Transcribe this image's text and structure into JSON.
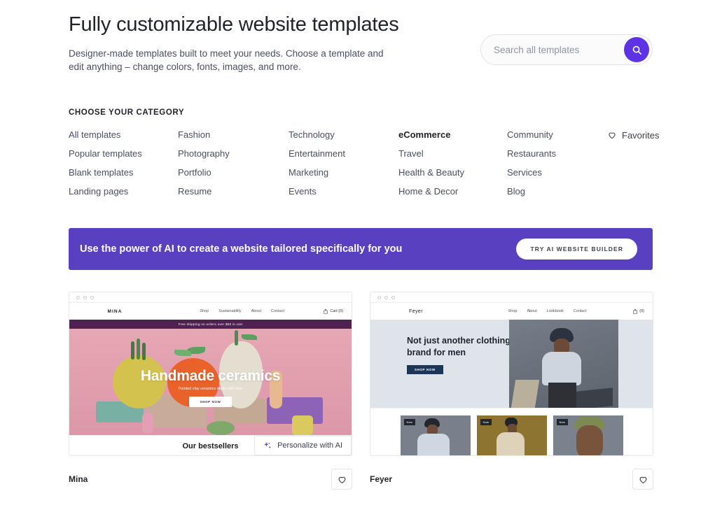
{
  "header": {
    "title": "Fully customizable website templates",
    "subtitle": "Designer-made templates built to meet your needs. Choose a template and edit anything – change colors, fonts, images, and more."
  },
  "search": {
    "placeholder": "Search all templates",
    "value": "",
    "button_icon": "search-icon",
    "button_color": "#5e33e6"
  },
  "categories": {
    "heading": "CHOOSE YOUR CATEGORY",
    "columns": [
      [
        "All templates",
        "Popular templates",
        "Blank templates",
        "Landing pages"
      ],
      [
        "Fashion",
        "Photography",
        "Portfolio",
        "Resume"
      ],
      [
        "Technology",
        "Entertainment",
        "Marketing",
        "Events"
      ],
      [
        "eCommerce",
        "Travel",
        "Health & Beauty",
        "Home & Decor"
      ],
      [
        "Community",
        "Restaurants",
        "Services",
        "Blog"
      ]
    ],
    "active": "eCommerce",
    "favorites": {
      "label": "Favorites",
      "icon": "heart-icon"
    }
  },
  "ai_banner": {
    "text": "Use the power of AI to create a website tailored specifically for you",
    "button_label": "TRY AI WEBSITE BUILDER",
    "background": "#5840c0"
  },
  "templates": [
    {
      "name": "Mina",
      "favorite_icon": "heart-icon",
      "personalize_label": "Personalize with AI",
      "personalize_icon": "sparkle-icon",
      "preview": {
        "logo": "MINA",
        "nav": [
          "Shop",
          "Sustainability",
          "About",
          "Contact"
        ],
        "cart": "Cart (0)",
        "announcement": "Free shipping on orders over $50 in cart",
        "hero_title": "Handmade ceramics",
        "hero_subtitle": "Painted clay ceramics made with love",
        "hero_button": "SHOP NOW",
        "section_title": "Our bestsellers",
        "accent": "#4e2150",
        "hero_background": "#e0a0ae"
      }
    },
    {
      "name": "Feyer",
      "favorite_icon": "heart-icon",
      "preview": {
        "logo": "Feyer",
        "nav": [
          "Shop",
          "About",
          "Lookbook",
          "Contact"
        ],
        "cart": "(0)",
        "hero_title": "Not just another clothing brand for men",
        "hero_button": "SHOP NOW",
        "products": [
          {
            "badge": "New"
          },
          {
            "badge": "Sale"
          },
          {
            "badge": "New"
          }
        ],
        "accent": "#1d3557",
        "hero_background": "#dfe3ea"
      }
    }
  ]
}
